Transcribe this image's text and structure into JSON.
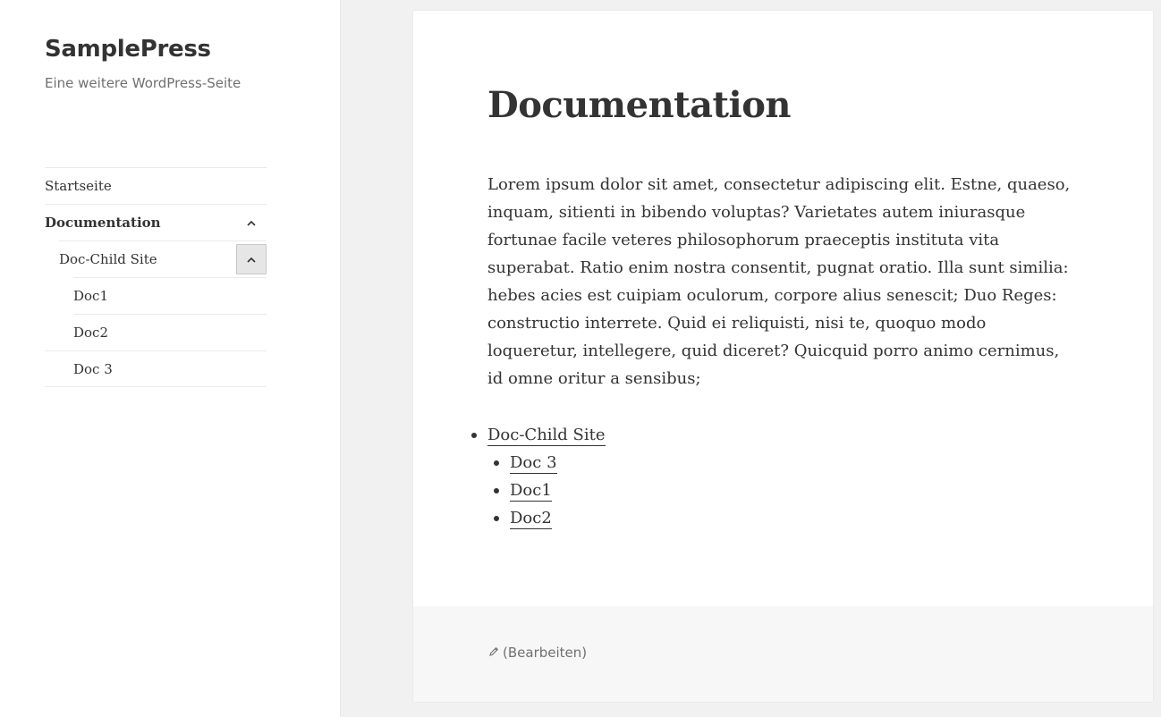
{
  "site": {
    "title": "SamplePress",
    "description": "Eine weitere WordPress-Seite"
  },
  "menu": {
    "items": [
      {
        "label": "Startseite"
      },
      {
        "label": "Documentation",
        "icon": "chevron-up-icon"
      },
      {
        "label": "Doc-Child Site",
        "icon": "chevron-up-icon"
      },
      {
        "label": "Doc1"
      },
      {
        "label": "Doc2"
      },
      {
        "label": "Doc 3"
      }
    ]
  },
  "page": {
    "title": "Documentation",
    "body": "Lorem ipsum dolor sit amet, consectetur adipiscing elit. Estne, quaeso, inquam, sitienti in bibendo voluptas? Varietates autem iniurasque fortunae facile veteres philosophorum praeceptis instituta vita superabat. Ratio enim nostra consentit, pugnat oratio. Illa sunt similia: hebes acies est cuipiam oculorum, corpore alius senescit; Duo Reges: constructio interrete. Quid ei reliquisti, nisi te, quoquo modo loqueretur, intellegere, quid diceret? Quicquid porro animo cernimus, id omne oritur a sensibus;",
    "child_list": {
      "parent": "Doc-Child Site",
      "children": [
        "Doc 3",
        "Doc1",
        "Doc2"
      ]
    }
  },
  "footer": {
    "edit_label": "(Bearbeiten)",
    "edit_icon": "pencil-icon"
  },
  "colors": {
    "background": "#f1f1f1",
    "text": "#333333",
    "muted": "#707070"
  }
}
